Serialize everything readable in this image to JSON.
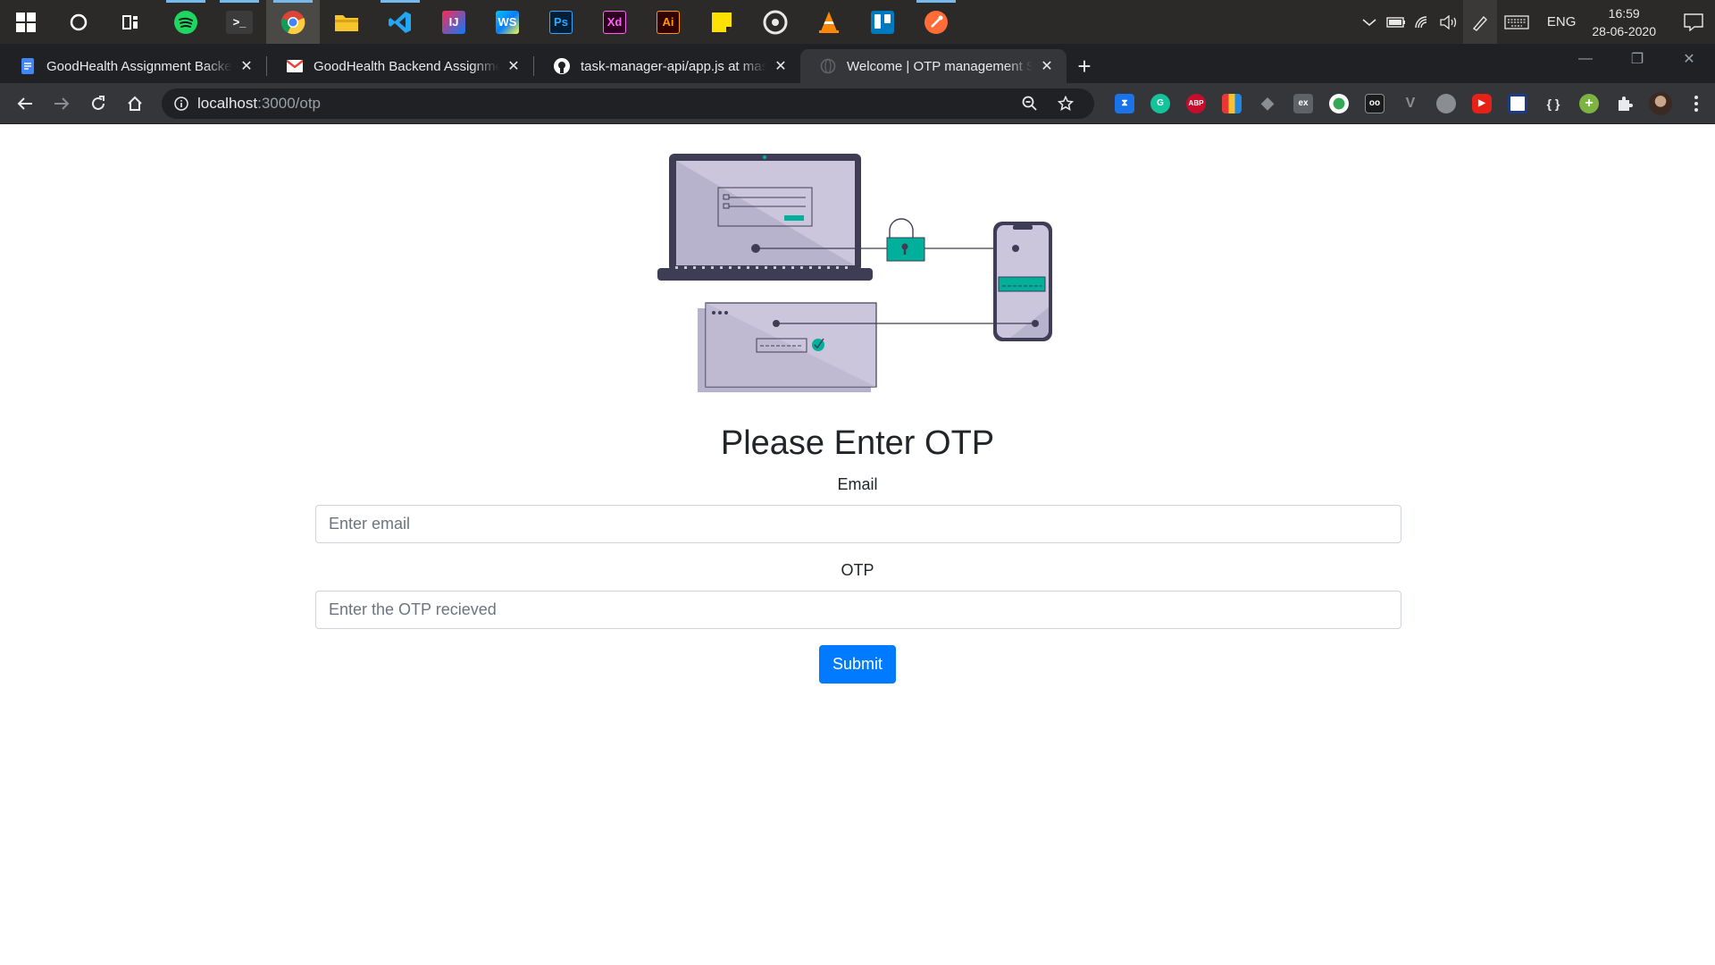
{
  "taskbar": {
    "apps": [
      {
        "name": "cortana",
        "glyph": ""
      },
      {
        "name": "task-view",
        "glyph": ""
      },
      {
        "name": "spotify",
        "glyph": ""
      },
      {
        "name": "terminal",
        "glyph": ">_"
      },
      {
        "name": "chrome",
        "glyph": ""
      },
      {
        "name": "file-explorer",
        "glyph": ""
      },
      {
        "name": "vscode",
        "glyph": ""
      },
      {
        "name": "intellij",
        "glyph": "IJ"
      },
      {
        "name": "webstorm",
        "glyph": "WS"
      },
      {
        "name": "photoshop",
        "glyph": "Ps"
      },
      {
        "name": "adobe-xd",
        "glyph": "Xd"
      },
      {
        "name": "illustrator",
        "glyph": "Ai"
      },
      {
        "name": "sticky-notes",
        "glyph": ""
      },
      {
        "name": "groove-music",
        "glyph": ""
      },
      {
        "name": "vlc",
        "glyph": ""
      },
      {
        "name": "trello",
        "glyph": ""
      },
      {
        "name": "postman",
        "glyph": ""
      }
    ],
    "tray": {
      "language": "ENG",
      "time": "16:59",
      "date": "28-06-2020"
    }
  },
  "browser": {
    "tabs": [
      {
        "title": "GoodHealth Assignment Backend",
        "favicon": "docs-icon",
        "active": false
      },
      {
        "title": "GoodHealth Backend Assignment",
        "favicon": "gmail-icon",
        "active": false
      },
      {
        "title": "task-manager-api/app.js at master",
        "favicon": "github-icon",
        "active": false
      },
      {
        "title": "Welcome | OTP management System",
        "favicon": "globe-icon",
        "active": true
      }
    ],
    "url_host": "localhost",
    "url_path": ":3000/otp",
    "colors": {
      "frame": "#202124",
      "toolbar": "#35363a",
      "omnibox": "#202124"
    }
  },
  "page": {
    "heading": "Please Enter OTP",
    "email_label": "Email",
    "email_placeholder": "Enter email",
    "otp_label": "OTP",
    "otp_placeholder": "Enter the OTP recieved",
    "submit_label": "Submit",
    "colors": {
      "primary": "#007bff",
      "accent": "#00b09b",
      "illustration_fill": "#cbc6dc",
      "illustration_dark": "#3f3d56"
    }
  }
}
